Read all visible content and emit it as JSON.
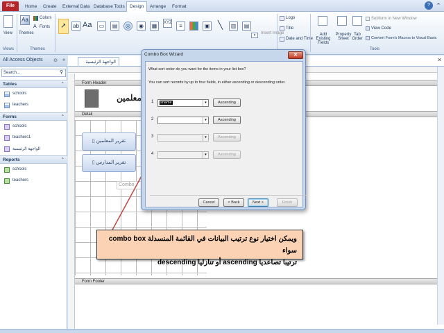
{
  "tabs": {
    "file": "File",
    "home": "Home",
    "create": "Create",
    "external": "External Data",
    "dbtools": "Database Tools",
    "design": "Design",
    "arrange": "Arrange",
    "format": "Format"
  },
  "ribbon": {
    "view": "View",
    "themes": "Themes",
    "colors": "Colors",
    "fonts": "Fonts",
    "views_group": "Views",
    "themes_group": "Themes",
    "insert_image": "Insert Image",
    "logo": "Logo",
    "title": "Title",
    "date_time": "Date and Time",
    "add_fields": "Add Existing Fields",
    "property_sheet": "Property Sheet",
    "tab_order": "Tab Order",
    "subform": "Subform in New Window",
    "view_code": "View Code",
    "convert_macros": "Convert Form's Macros to Visual Basic",
    "tools_group": "Tools"
  },
  "nav": {
    "title": "All Access Objects",
    "search_placeholder": "Search...",
    "groups": [
      {
        "name": "Tables",
        "items": [
          "schools",
          "teachers"
        ]
      },
      {
        "name": "Forms",
        "items": [
          "schools",
          "teachers1",
          "الواجهة الرئيسية"
        ]
      },
      {
        "name": "Reports",
        "items": [
          "schools",
          "teachers"
        ]
      }
    ]
  },
  "document": {
    "tab": "الواجهة الرئيسية",
    "form_header": "Form Header",
    "detail": "Detail",
    "form_footer": "Form Footer",
    "header_title": "المعلمين",
    "btn_teachers": "تقرير المعلمين",
    "btn_schools": "تقرير المدارس",
    "combo_label": "Combo"
  },
  "dialog": {
    "title": "Combo Box Wizard",
    "question": "What sort order do you want for the items in your list box?",
    "hint": "You can sort records by up to four fields, in either ascending or descending order.",
    "rows": [
      {
        "num": "1",
        "value": "sname",
        "order": "Ascending"
      },
      {
        "num": "2",
        "value": "",
        "order": "Ascending"
      },
      {
        "num": "3",
        "value": "",
        "order": "Ascending"
      },
      {
        "num": "4",
        "value": "",
        "order": "Ascending"
      }
    ],
    "cancel": "Cancel",
    "back": "< Back",
    "next": "Next >",
    "finish": "Finish"
  },
  "callout": {
    "line1": "ويمكن اختيار نوع ترتيب البيانات في القائمة المنسدلة combo box سواء",
    "line2": "ترتيبا تصاعديا ascending أو تنازليا descending"
  },
  "colors": {
    "file_tab": "#b5262a",
    "callout_bg": "#fbd3b4",
    "arrow": "#c0504d"
  }
}
